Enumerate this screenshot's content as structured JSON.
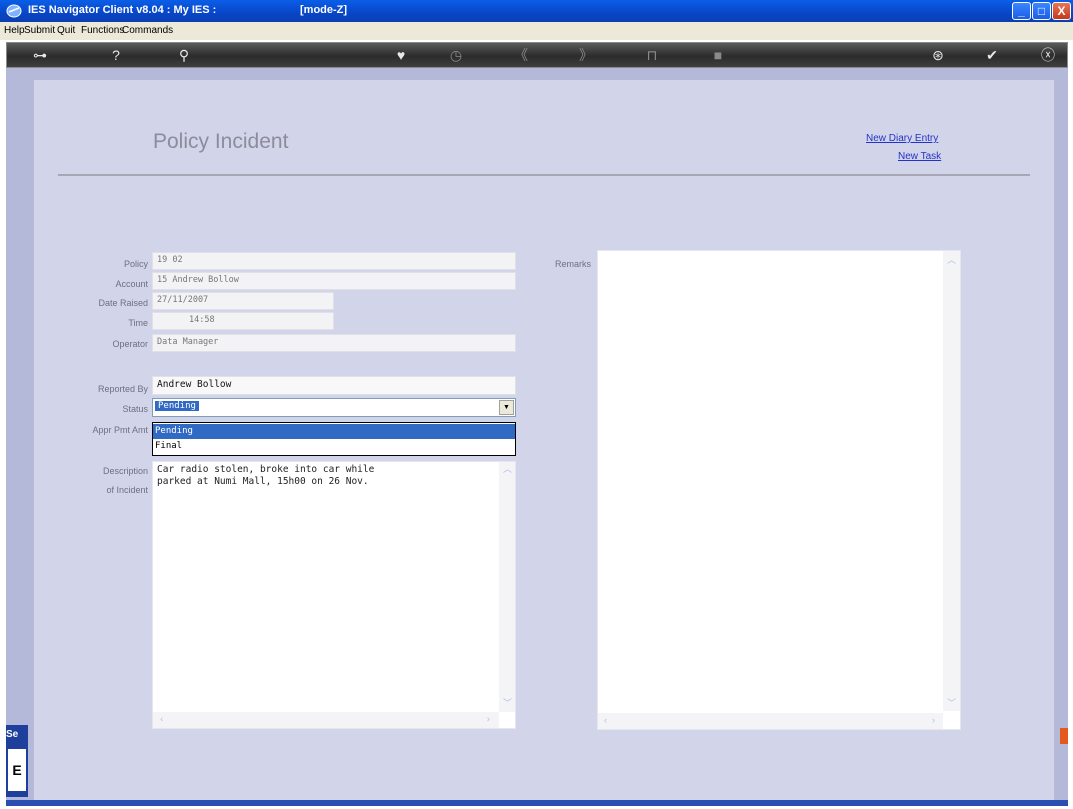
{
  "window": {
    "title": "IES Navigator Client v8.04 : My IES :",
    "mode": "[mode-Z]",
    "minimize": "_",
    "maximize": "□",
    "close": "X"
  },
  "menu": [
    "Help",
    "Submit",
    "Quit",
    "Functions",
    "Commands"
  ],
  "toolbar": {
    "icons": [
      "key-icon",
      "help-icon",
      "search-icon",
      "heart-icon",
      "clock-icon",
      "rewind-icon",
      "forward-icon",
      "stop-icon",
      "box-icon",
      "network-icon",
      "check-icon",
      "close-icon"
    ],
    "glyphs": [
      "⊶",
      "?",
      "⚲",
      "♥",
      "◷",
      "《",
      "》",
      "⊓",
      "■",
      "⊛",
      "✔",
      "ⓧ"
    ]
  },
  "page": {
    "title": "Policy Incident",
    "links": [
      "New Diary Entry",
      "New Task"
    ]
  },
  "form": {
    "policy_label": "Policy",
    "policy_value": "19 02",
    "account_label": "Account",
    "account_value": "15 Andrew Bollow",
    "date_label": "Date Raised",
    "date_value": "27/11/2007",
    "time_label": "Time",
    "time_value": "14:58",
    "operator_label": "Operator",
    "operator_value": "Data Manager",
    "reported_label": "Reported By",
    "reported_value": "Andrew Bollow",
    "status_label": "Status",
    "status_value": "Pending",
    "status_options": [
      "Pending",
      "Final"
    ],
    "appr_label": "Appr Pmt Amt",
    "description_label_1": "Description",
    "description_label_2": "of Incident",
    "description_line_1": "Car radio stolen, broke into car while",
    "description_line_2": "parked at Numi Mall, 15h00 on 26 Nov.",
    "remarks_label": "Remarks",
    "remarks_value": ""
  },
  "sidebar_tab": {
    "label": "Se",
    "box": "E"
  }
}
